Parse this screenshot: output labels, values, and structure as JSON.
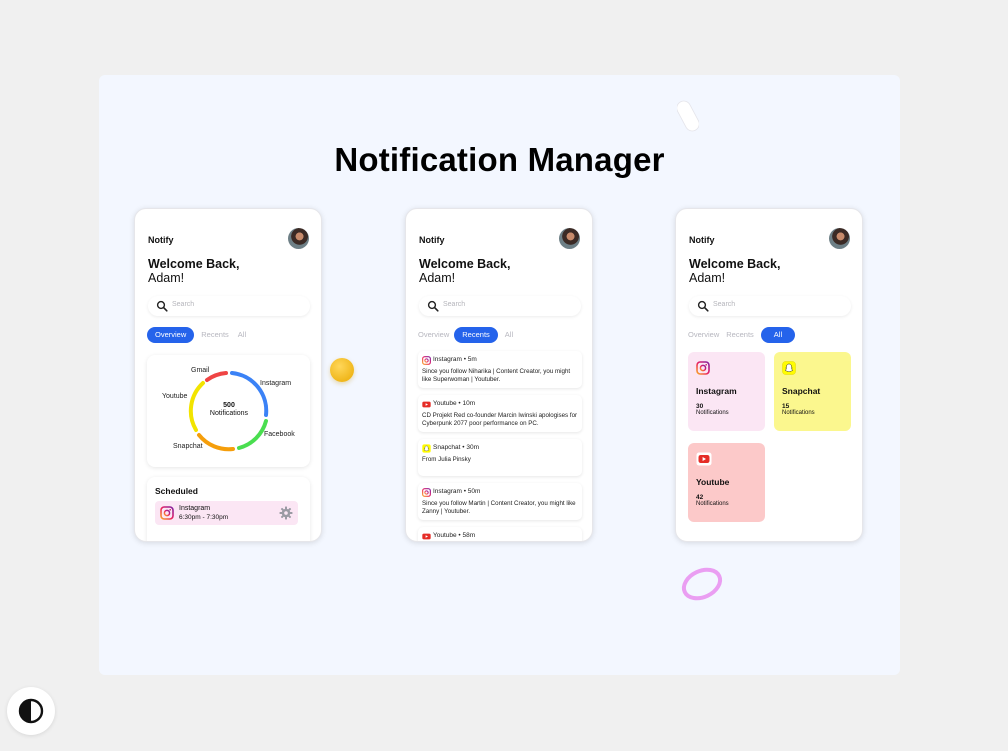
{
  "page_title": "Notification Manager",
  "app_name": "Notify",
  "welcome_line1": "Welcome Back,",
  "welcome_line2": "Adam!",
  "search_placeholder": "Search",
  "tabs": [
    "Overview",
    "Recents",
    "All"
  ],
  "colors": {
    "accent": "#2563eb",
    "canvas": "#f3f7ff",
    "gmail": "#ef4444",
    "instagram": "#3b82f6",
    "facebook": "#22c55e",
    "snapchat": "#f59e0b",
    "youtube": "#facc15"
  },
  "overview": {
    "donut_total": "500",
    "donut_caption": "Notifications",
    "legend": [
      "Gmail",
      "Instagram",
      "Youtube",
      "Facebook",
      "Snapchat"
    ],
    "scheduled_title": "Scheduled",
    "scheduled_item": {
      "app": "Instagram",
      "time": "6:30pm - 7:30pm",
      "icon": "instagram-icon"
    }
  },
  "recents": [
    {
      "app": "Instagram",
      "time": "5m",
      "text": "Since you follow Niharika | Content Creator, you might like Superwoman | Youtuber.",
      "icon": "instagram-icon"
    },
    {
      "app": "Youtube",
      "time": "10m",
      "text": "CD Projekt Red co-founder Marcin Iwinski apologises for Cyberpunk 2077 poor performance on PC.",
      "icon": "youtube-icon"
    },
    {
      "app": "Snapchat",
      "time": "30m",
      "text": "From Julia Pinsky",
      "icon": "snapchat-icon"
    },
    {
      "app": "Instagram",
      "time": "50m",
      "text": "Since you follow Martin | Content Creator, you might like Zanny | Youtuber.",
      "icon": "instagram-icon"
    },
    {
      "app": "Youtube",
      "time": "58m",
      "text": "",
      "icon": "youtube-icon"
    }
  ],
  "all_tiles": [
    {
      "app": "Instagram",
      "count": "30",
      "label": "Notifications",
      "icon": "instagram-icon"
    },
    {
      "app": "Snapchat",
      "count": "15",
      "label": "Notifications",
      "icon": "snapchat-icon"
    },
    {
      "app": "Youtube",
      "count": "42",
      "label": "Notifications",
      "icon": "youtube-icon"
    }
  ],
  "theme_toggle_icon": "contrast-icon"
}
